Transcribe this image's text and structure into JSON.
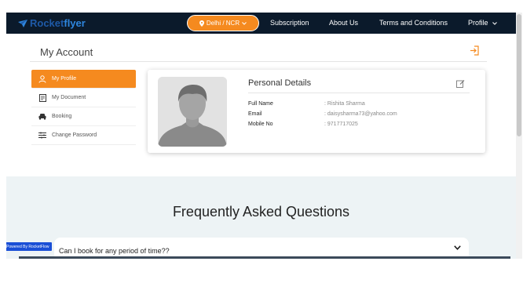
{
  "brand": {
    "part1": "Rocket",
    "part2": "flyer"
  },
  "nav": {
    "city": "Delhi / NCR",
    "links": [
      "Subscription",
      "About Us",
      "Terms and Conditions",
      "Profile"
    ]
  },
  "account": {
    "title": "My Account",
    "menu": [
      "My Profile",
      "My Document",
      "Booking",
      "Change Password"
    ]
  },
  "details": {
    "title": "Personal Details",
    "fields": [
      {
        "label": "Full Name",
        "value": ": Rishita Sharma"
      },
      {
        "label": "Email",
        "value": ": daisysharma73@yahoo.com"
      },
      {
        "label": "Mobile No",
        "value": ": 9717717025"
      }
    ]
  },
  "faq": {
    "title": "Frequently Asked Questions",
    "question": "Can I book for any period of time??"
  },
  "powered_by": "Powered By RocketFlow",
  "colors": {
    "accent": "#f58a1f",
    "nav_bg": "#0b1a2b",
    "faq_bg": "#edf3f5"
  },
  "icons": [
    "rocket-logo-icon",
    "location-pin-icon",
    "chevron-down-icon",
    "logout-icon",
    "user-icon",
    "document-icon",
    "car-icon",
    "password-icon",
    "edit-icon",
    "avatar-placeholder"
  ]
}
